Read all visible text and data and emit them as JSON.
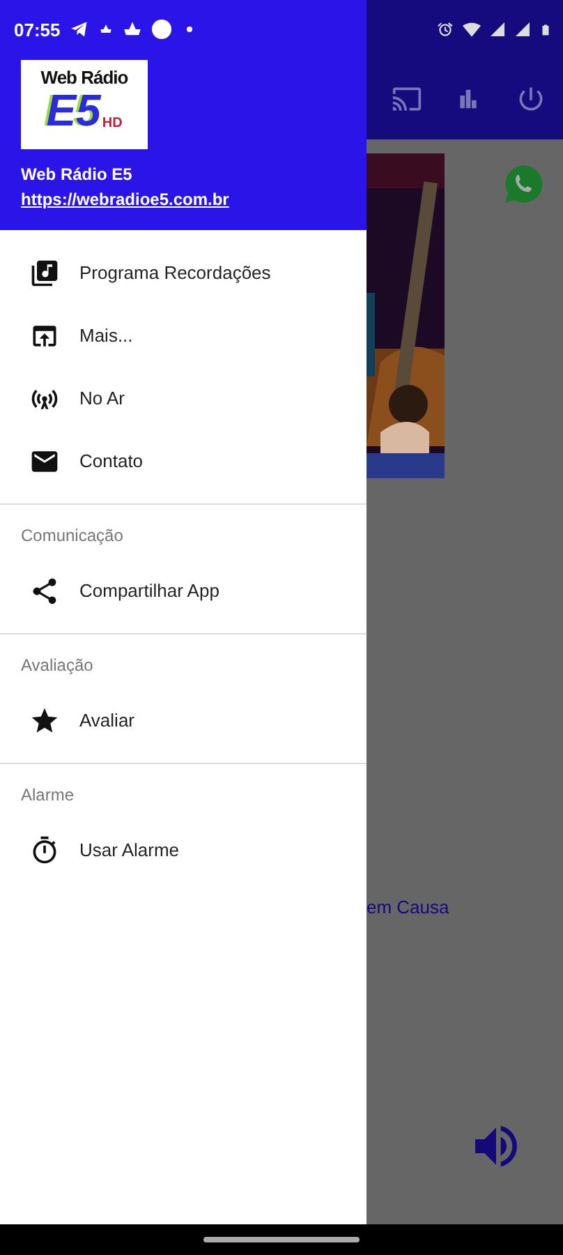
{
  "status_bar": {
    "time": "07:55"
  },
  "drawer": {
    "logo": {
      "top": "Web Rádio",
      "main": "E5",
      "badge": "HD"
    },
    "title": "Web Rádio E5",
    "link": "https://webradioe5.com.br",
    "sections": [
      {
        "items": [
          {
            "label": "Programa Recordações",
            "kind": "music-library"
          },
          {
            "label": "Mais...",
            "kind": "upload-window"
          },
          {
            "label": "No Ar",
            "kind": "antenna"
          },
          {
            "label": "Contato",
            "kind": "mail"
          }
        ]
      },
      {
        "label": "Comunicação",
        "items": [
          {
            "label": "Compartilhar App",
            "kind": "share"
          }
        ]
      },
      {
        "label": "Avaliação",
        "items": [
          {
            "label": "Avaliar",
            "kind": "star"
          }
        ]
      },
      {
        "label": "Alarme",
        "items": [
          {
            "label": "Usar Alarme",
            "kind": "timer"
          }
        ]
      }
    ]
  },
  "background_app": {
    "text": "em Causa"
  }
}
